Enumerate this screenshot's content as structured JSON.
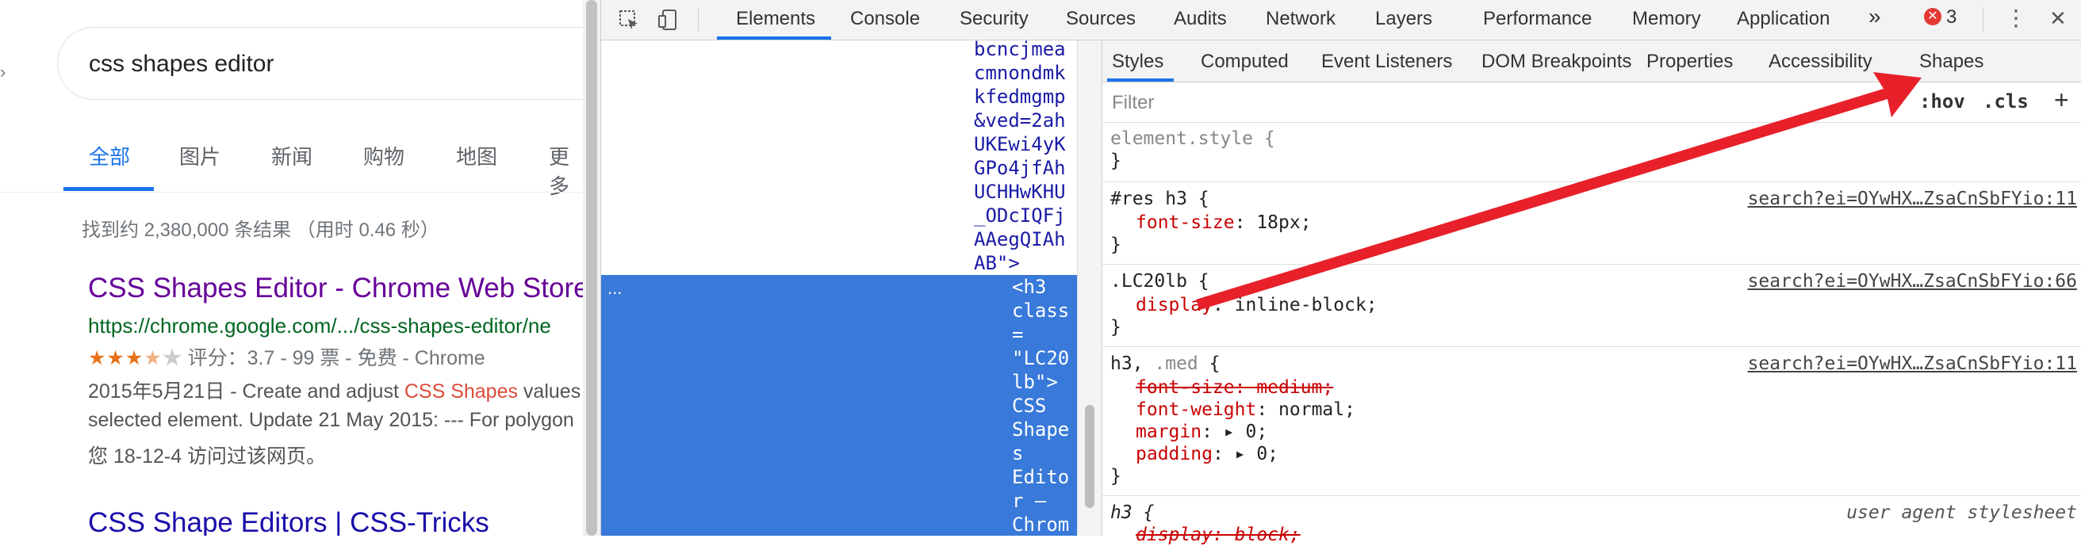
{
  "search": {
    "query": "css shapes editor",
    "tabs": [
      "全部",
      "图片",
      "新闻",
      "购物",
      "地图",
      "更多"
    ],
    "result_stats": "找到约 2,380,000 条结果 （用时 0.46 秒）",
    "results": [
      {
        "title": "CSS Shapes Editor - Chrome Web Store",
        "url": "https://chrome.google.com/.../css-shapes-editor/ne",
        "stars": "★★★",
        "half_star": "★",
        "empty_star": "★",
        "rating_text": " 评分：3.7 - 99 票 - 免费 - Chrome",
        "snippet_1_prefix": "2015年5月21日 - Create and adjust ",
        "snippet_1_highlight": "CSS Shapes",
        "snippet_1_suffix": " values",
        "snippet_2": "selected element. Update 21 May 2015: --- For polygon",
        "snippet_3": "您 18-12-4 访问过该网页。"
      },
      {
        "title": "CSS Shape Editors | CSS-Tricks"
      }
    ]
  },
  "devtools": {
    "main_tabs": [
      "Elements",
      "Console",
      "Security",
      "Sources",
      "Audits",
      "Network",
      "Layers",
      "Performance",
      "Memory",
      "Application"
    ],
    "more_tabs": "»",
    "error_count": "3",
    "error_badge": "✕",
    "menu_icon": "⋮",
    "close_icon": "✕",
    "dom_lines": [
      "bcncjmea",
      "cmnondmk",
      "kfedmgmp",
      "&ved=2ah",
      "UKEwi4yK",
      "GPo4jfAh",
      "UCHHwKHU",
      "_ODcIQFj",
      "AAegQIAh",
      "AB\">"
    ],
    "selected_lines": [
      "<h3",
      "class",
      "=",
      "\"LC20",
      "lb\">",
      "CSS",
      "Shape",
      "s",
      "Edito",
      "r –",
      "Chrom"
    ],
    "selected_dots": "...",
    "sub_tabs": [
      "Styles",
      "Computed",
      "Event Listeners",
      "DOM Breakpoints",
      "Properties",
      "Accessibility",
      "Shapes"
    ],
    "filter_placeholder": "Filter",
    "hov": ":hov",
    "cls": ".cls",
    "plus": "+",
    "rules": {
      "element_style": "element.style {",
      "close_brace": "}",
      "res_h3_selector": "#res h3 {",
      "res_h3_source": "search?ei=OYwHX…ZsaCnSbFYio:11",
      "res_h3_prop": "font-size",
      "res_h3_value": ": 18px;",
      "lc20_selector": ".LC20lb {",
      "lc20_source": "search?ei=OYwHX…ZsaCnSbFYio:66",
      "lc20_prop": "display",
      "lc20_value": ": inline-block;",
      "h3med_selector_a": "h3, ",
      "h3med_selector_b": ".med",
      "h3med_selector_c": " {",
      "h3med_source": "search?ei=OYwHX…ZsaCnSbFYio:11",
      "h3med_p1": "font-size: medium;",
      "h3med_p2_name": "font-weight",
      "h3med_p2_value": ": normal;",
      "h3med_p3_name": "margin",
      "h3med_p3_value": ": ▸ 0;",
      "h3med_p4_name": "padding",
      "h3med_p4_value": ": ▸ 0;",
      "ua_selector": "h3 {",
      "ua_source": "user agent stylesheet",
      "ua_p1": "display: block;"
    }
  },
  "annotation": {
    "arrow_color": "#e8202a"
  }
}
